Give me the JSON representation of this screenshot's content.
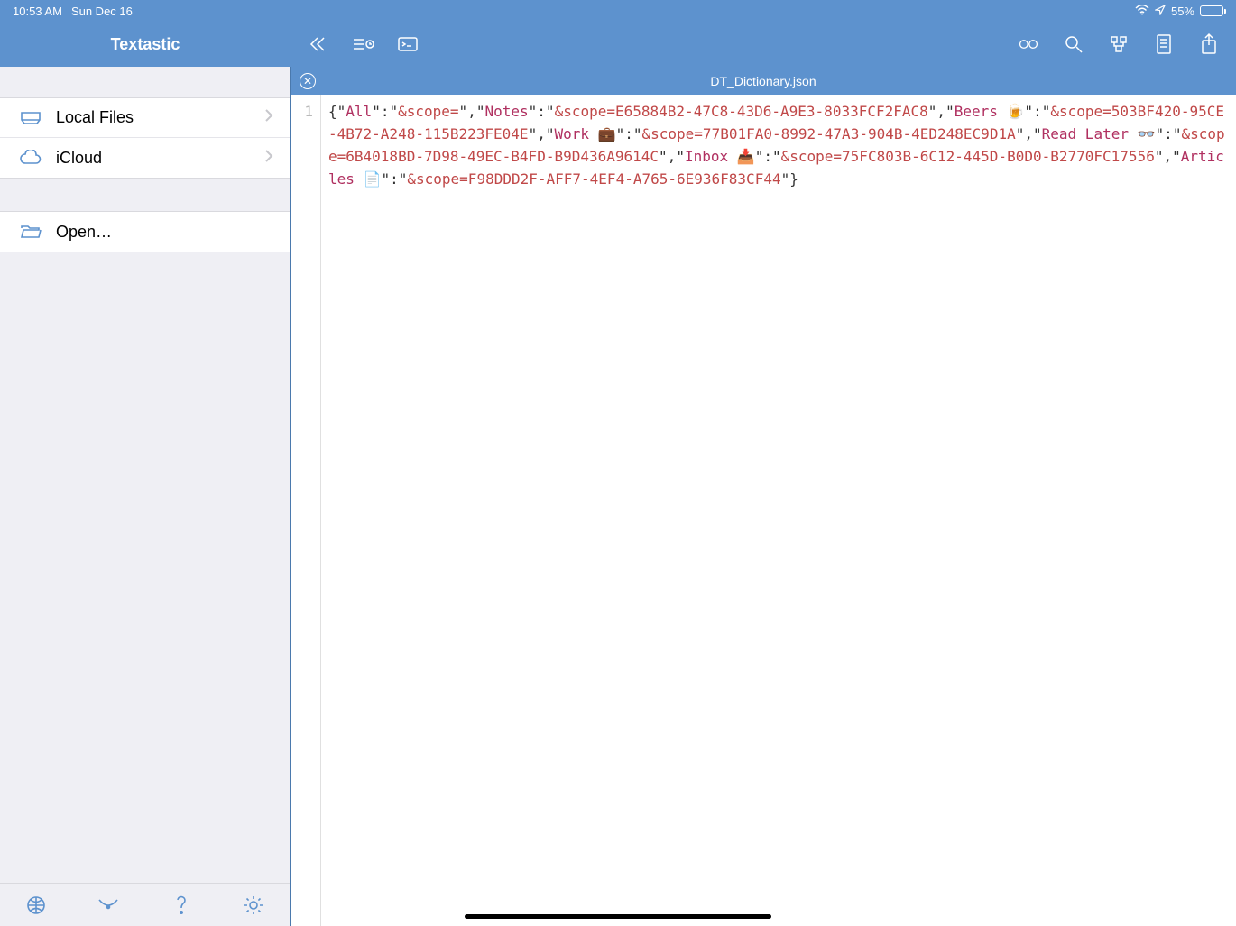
{
  "status": {
    "time": "10:53 AM",
    "date": "Sun Dec 16",
    "battery_pct": "55%"
  },
  "app_title": "Textastic",
  "sidebar": {
    "group1": [
      {
        "label": "Local Files"
      },
      {
        "label": "iCloud"
      }
    ],
    "group2": [
      {
        "label": "Open…"
      }
    ]
  },
  "file": {
    "name": "DT_Dictionary.json",
    "line_no": "1"
  },
  "json_keys": {
    "All": "All",
    "Notes": "Notes",
    "Beers": "Beers ",
    "Work": "Work ",
    "ReadLater": "Read Later ",
    "Inbox": "Inbox ",
    "Articles": "Articles "
  },
  "json_vals": {
    "All": "&scope=",
    "Notes": "&scope=E65884B2-47C8-43D6-A9E3-8033FCF2FAC8",
    "Beers": "&scope=503BF420-95CE-4B72-A248-115B223FE04E",
    "Work": "&scope=77B01FA0-8992-47A3-904B-4ED248EC9D1A",
    "ReadLater": "&scope=6B4018BD-7D98-49EC-B4FD-B9D436A9614C",
    "Inbox": "&scope=75FC803B-6C12-445D-B0D0-B2770FC17556",
    "Articles": "&scope=F98DDD2F-AFF7-4EF4-A765-6E936F83CF44"
  },
  "emoji": {
    "Beers": "🍺",
    "Work": "💼",
    "ReadLater": "👓",
    "Inbox": "📥",
    "Articles": "📄"
  }
}
